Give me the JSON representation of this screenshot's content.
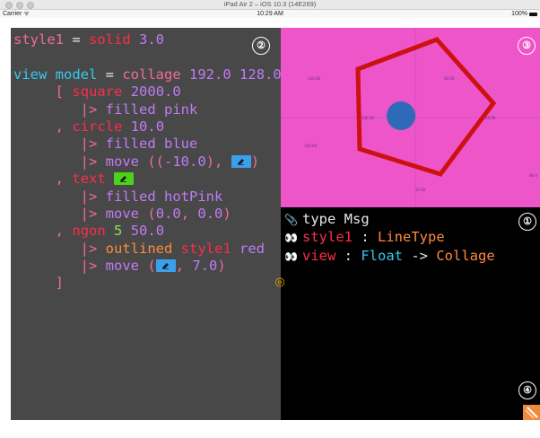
{
  "window": {
    "title": "iPad Air 2 – iOS 10.3 (14E269)"
  },
  "status_bar": {
    "carrier": "Carrier",
    "time": "10:29 AM",
    "battery": "100%"
  },
  "editor": {
    "badge": "②",
    "lines": [
      [
        [
          "kw-pink",
          "style1"
        ],
        [
          "kw-white",
          " = "
        ],
        [
          "kw-red",
          "solid"
        ],
        [
          "kw-white",
          " "
        ],
        [
          "kw-purple",
          "3.0"
        ]
      ],
      [],
      [
        [
          "kw-cyan",
          "view"
        ],
        [
          "kw-white",
          " "
        ],
        [
          "kw-cyan",
          "model"
        ],
        [
          "kw-white",
          " = "
        ],
        [
          "kw-pink",
          "collage"
        ],
        [
          "kw-white",
          " "
        ],
        [
          "kw-purple",
          "192.0"
        ],
        [
          "kw-white",
          " "
        ],
        [
          "kw-purple",
          "128.0"
        ]
      ],
      [
        [
          "kw-white",
          "     "
        ],
        [
          "kw-pink",
          "["
        ],
        [
          "kw-white",
          " "
        ],
        [
          "kw-red",
          "square"
        ],
        [
          "kw-white",
          " "
        ],
        [
          "kw-purple",
          "2000.0"
        ]
      ],
      [
        [
          "kw-white",
          "        "
        ],
        [
          "kw-pink",
          "|>"
        ],
        [
          "kw-white",
          " "
        ],
        [
          "kw-purple",
          "filled"
        ],
        [
          "kw-white",
          " "
        ],
        [
          "kw-purple",
          "pink"
        ]
      ],
      [
        [
          "kw-white",
          "     "
        ],
        [
          "kw-pink",
          ","
        ],
        [
          "kw-white",
          " "
        ],
        [
          "kw-red",
          "circle"
        ],
        [
          "kw-white",
          " "
        ],
        [
          "kw-purple",
          "10.0"
        ]
      ],
      [
        [
          "kw-white",
          "        "
        ],
        [
          "kw-pink",
          "|>"
        ],
        [
          "kw-white",
          " "
        ],
        [
          "kw-purple",
          "filled"
        ],
        [
          "kw-white",
          " "
        ],
        [
          "kw-purple",
          "blue"
        ]
      ],
      [
        [
          "kw-white",
          "        "
        ],
        [
          "kw-pink",
          "|>"
        ],
        [
          "kw-white",
          " "
        ],
        [
          "kw-purple",
          "move"
        ],
        [
          "kw-white",
          " "
        ],
        [
          "kw-pink",
          "(("
        ],
        [
          "kw-purple",
          "-10.0"
        ],
        [
          "kw-pink",
          "), "
        ],
        [
          "chip",
          "blue"
        ],
        [
          "kw-pink",
          ")"
        ]
      ],
      [
        [
          "kw-white",
          "     "
        ],
        [
          "kw-pink",
          ","
        ],
        [
          "kw-white",
          " "
        ],
        [
          "kw-red",
          "text"
        ],
        [
          "kw-white",
          " "
        ],
        [
          "chip",
          "green"
        ]
      ],
      [
        [
          "kw-white",
          "        "
        ],
        [
          "kw-pink",
          "|>"
        ],
        [
          "kw-white",
          " "
        ],
        [
          "kw-purple",
          "filled"
        ],
        [
          "kw-white",
          " "
        ],
        [
          "kw-purple",
          "hotPink"
        ]
      ],
      [
        [
          "kw-white",
          "        "
        ],
        [
          "kw-pink",
          "|>"
        ],
        [
          "kw-white",
          " "
        ],
        [
          "kw-purple",
          "move"
        ],
        [
          "kw-white",
          " "
        ],
        [
          "kw-pink",
          "("
        ],
        [
          "kw-purple",
          "0.0"
        ],
        [
          "kw-pink",
          ", "
        ],
        [
          "kw-purple",
          "0.0"
        ],
        [
          "kw-pink",
          ")"
        ]
      ],
      [
        [
          "kw-white",
          "     "
        ],
        [
          "kw-pink",
          ","
        ],
        [
          "kw-white",
          " "
        ],
        [
          "kw-red",
          "ngon"
        ],
        [
          "kw-white",
          " "
        ],
        [
          "kw-green",
          "5"
        ],
        [
          "kw-white",
          " "
        ],
        [
          "kw-purple",
          "50.0"
        ]
      ],
      [
        [
          "kw-white",
          "        "
        ],
        [
          "kw-pink",
          "|>"
        ],
        [
          "kw-white",
          " "
        ],
        [
          "kw-orange",
          "outlined"
        ],
        [
          "kw-white",
          " "
        ],
        [
          "kw-red",
          "style1"
        ],
        [
          "kw-white",
          " "
        ],
        [
          "kw-purple",
          "red"
        ]
      ],
      [
        [
          "kw-white",
          "        "
        ],
        [
          "kw-pink",
          "|>"
        ],
        [
          "kw-white",
          " "
        ],
        [
          "kw-purple",
          "move"
        ],
        [
          "kw-white",
          " "
        ],
        [
          "kw-pink",
          "("
        ],
        [
          "chip",
          "blue"
        ],
        [
          "kw-pink",
          ", "
        ],
        [
          "kw-purple",
          "7.0"
        ],
        [
          "kw-pink",
          ")"
        ]
      ],
      [
        [
          "kw-white",
          "     "
        ],
        [
          "kw-pink",
          "]"
        ]
      ]
    ]
  },
  "canvas": {
    "badge": "③",
    "background": "#ee55c8",
    "axis_labels": [
      "140.00",
      "60.00",
      "130.00",
      "20.00",
      "140.00",
      "30.00",
      "96.4"
    ],
    "pentagon_color": "#cc1111",
    "circle_color": "#2f6ab8"
  },
  "types": {
    "badge": "①",
    "corner_badge": "④",
    "lines": [
      [
        [
          "icon",
          "paperclip-icon",
          "📎"
        ],
        [
          "kw-white",
          "type Msg"
        ]
      ],
      [
        [
          "icon",
          "eyes-icon",
          "👀"
        ],
        [
          "kw-red",
          "style1"
        ],
        [
          "kw-white",
          " : "
        ],
        [
          "kw-orange",
          "LineType"
        ]
      ],
      [
        [
          "icon",
          "eyes-icon",
          "👀"
        ],
        [
          "kw-red",
          "view"
        ],
        [
          "kw-white",
          " : "
        ],
        [
          "kw-cyan",
          "Float"
        ],
        [
          "kw-white",
          " -> "
        ],
        [
          "kw-orange",
          "Collage"
        ]
      ]
    ]
  },
  "divider": {
    "glyph": "◎"
  }
}
